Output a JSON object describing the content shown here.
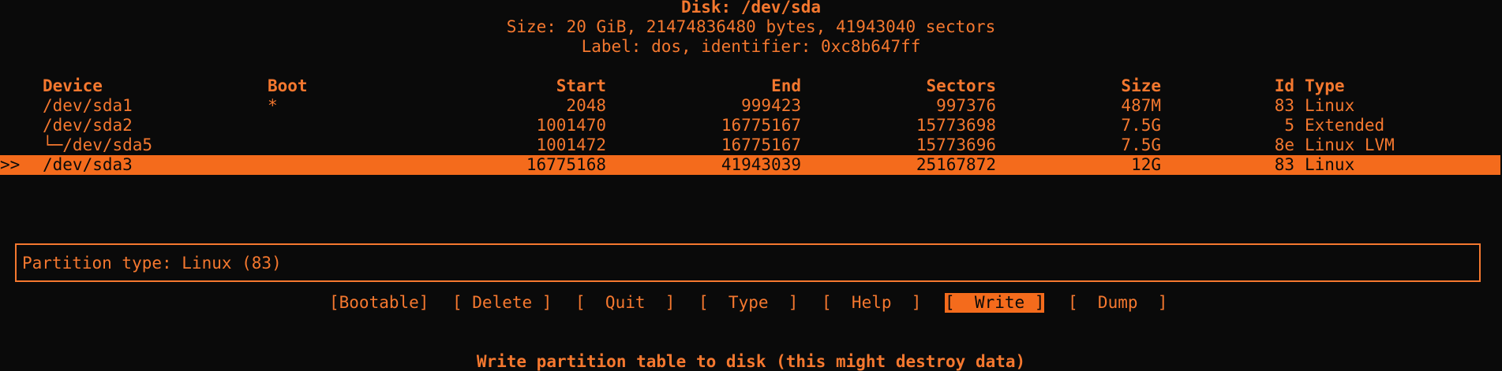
{
  "header": {
    "disk": "Disk: /dev/sda",
    "size": "Size: 20 GiB, 21474836480 bytes, 41943040 sectors",
    "label": "Label: dos, identifier: 0xc8b647ff"
  },
  "table": {
    "columns": {
      "device": "Device",
      "boot": "Boot",
      "start": "Start",
      "end": "End",
      "sectors": "Sectors",
      "size": "Size",
      "id": "Id",
      "type": "Type"
    },
    "rows": [
      {
        "marker": "",
        "device": "/dev/sda1",
        "boot": "*",
        "start": "2048",
        "end": "999423",
        "sectors": "997376",
        "size": "487M",
        "id": "83",
        "type": "Linux"
      },
      {
        "marker": "",
        "device": "/dev/sda2",
        "boot": "",
        "start": "1001470",
        "end": "16775167",
        "sectors": "15773698",
        "size": "7.5G",
        "id": "5",
        "type": "Extended"
      },
      {
        "marker": "",
        "device": "└─/dev/sda5",
        "boot": "",
        "start": "1001472",
        "end": "16775167",
        "sectors": "15773696",
        "size": "7.5G",
        "id": "8e",
        "type": "Linux LVM"
      },
      {
        "marker": ">>",
        "device": "/dev/sda3",
        "boot": "",
        "start": "16775168",
        "end": "41943039",
        "sectors": "25167872",
        "size": "12G",
        "id": "83",
        "type": "Linux",
        "selected": true
      }
    ]
  },
  "info": {
    "text": "Partition type: Linux (83)"
  },
  "menu": {
    "bootable": "[Bootable]",
    "delete": "[ Delete ]",
    "quit": "[  Quit  ]",
    "type": "[  Type  ]",
    "help": "[  Help  ]",
    "write": "[  Write ]",
    "dump": "[  Dump  ]",
    "active": "write"
  },
  "status": {
    "text": "Write partition table to disk (this might destroy data)"
  },
  "colors": {
    "background": "#0a0a0a",
    "foreground": "#f5782f",
    "highlight": "#f46b1c"
  }
}
